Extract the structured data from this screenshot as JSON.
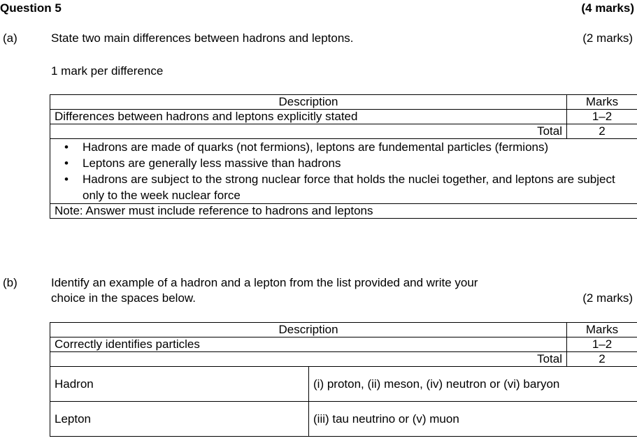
{
  "question": {
    "title": "Question 5",
    "marks": "(4 marks)"
  },
  "part_a": {
    "label": "(a)",
    "prompt": "State two main differences between hadrons and leptons.",
    "marks": "(2 marks)",
    "note": "1 mark per difference",
    "table": {
      "headers": {
        "description": "Description",
        "marks": "Marks"
      },
      "criterion": {
        "text": "Differences between hadrons and leptons explicitly stated",
        "marks": "1–2"
      },
      "total": {
        "label": "Total",
        "value": "2"
      },
      "bullets": [
        "Hadrons are made of quarks (not fermions), leptons are fundemental particles (fermions)",
        "Leptons are generally less massive than hadrons",
        "Hadrons are subject to the strong nuclear force that holds the nuclei together, and leptons are subject only to the week nuclear force"
      ],
      "footnote": "Note: Answer must include reference to hadrons and leptons"
    }
  },
  "part_b": {
    "label": "(b)",
    "prompt_line1": "Identify an example of a hadron and a lepton from the list provided and write your",
    "prompt_line2": "choice in the spaces below.",
    "marks": "(2 marks)",
    "table": {
      "headers": {
        "description": "Description",
        "marks": "Marks"
      },
      "criterion": {
        "text": "Correctly identifies particles",
        "marks": "1–2"
      },
      "total": {
        "label": "Total",
        "value": "2"
      },
      "rows": [
        {
          "label": "Hadron",
          "answer": "(i) proton, (ii) meson, (iv) neutron or (vi) baryon"
        },
        {
          "label": "Lepton",
          "answer": "(iii) tau neutrino or (v) muon"
        }
      ]
    }
  }
}
